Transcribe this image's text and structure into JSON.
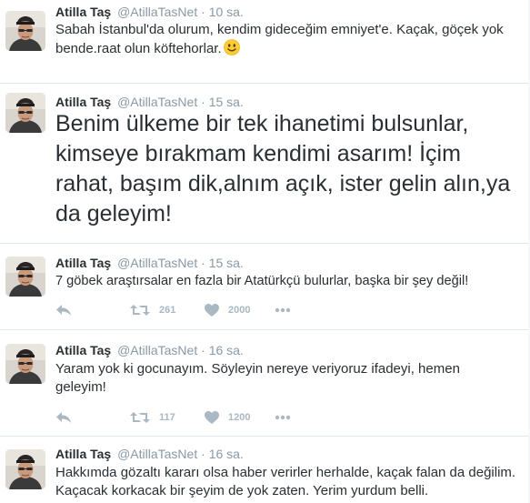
{
  "colors": {
    "name": "#292f33",
    "meta": "#8899a6",
    "action": "#aab8c2",
    "divider": "#e1e8ed"
  },
  "tweets": [
    {
      "name": "Atilla Taş",
      "handle": "@AtillaTasNet",
      "sep": "·",
      "time": "10 sa.",
      "text": "Sabah İstanbul'da olurum, kendim gideceğim emniyet'e. Kaçak, göçek yok bende.raat olun köftehorlar.",
      "emoji": "smiling-face-emoji"
    },
    {
      "name": "Atilla Taş",
      "handle": "@AtillaTasNet",
      "sep": "·",
      "time": "15 sa.",
      "text": "Benim ülkeme bir tek ihanetimi bulsunlar, kimseye bırakmam kendimi asarım! İçim rahat, başım dik,alnım açık, ister gelin alın,ya da geleyim!"
    },
    {
      "name": "Atilla Taş",
      "handle": "@AtillaTasNet",
      "sep": "·",
      "time": "15 sa.",
      "text": "7 göbek araştırsalar en fazla bir Atatürkçü bulurlar, başka bir şey değil!",
      "retweets": "261",
      "likes": "2000"
    },
    {
      "name": "Atilla Taş",
      "handle": "@AtillaTasNet",
      "sep": "·",
      "time": "16 sa.",
      "text": "Yaram yok ki gocunayım. Söyleyin nereye veriyoruz ifadeyi, hemen geleyim!",
      "retweets": "117",
      "likes": "1200"
    },
    {
      "name": "Atilla Taş",
      "handle": "@AtillaTasNet",
      "sep": "·",
      "time": "16 sa.",
      "text": "Hakkımda gözaltı kararı olsa haber verirler herhalde, kaçak falan da değilim. Kaçacak korkacak bir şeyim de yok zaten. Yerim yurdum belli."
    }
  ]
}
